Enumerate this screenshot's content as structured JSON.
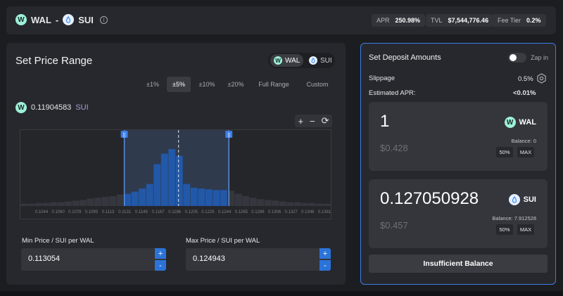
{
  "header": {
    "token_a": "WAL",
    "separator": "-",
    "token_b": "SUI",
    "info_glyph": "i",
    "stats": [
      {
        "label": "APR",
        "value": "250.98%"
      },
      {
        "label": "TVL",
        "value": "$7,544,776.46"
      },
      {
        "label": "Fee Tier",
        "value": "0.2%"
      }
    ]
  },
  "range_panel": {
    "title": "Set Price Range",
    "token_toggle": {
      "token_a": "WAL",
      "token_b": "SUI",
      "selected": "WAL"
    },
    "range_options": [
      "±1%",
      "±5%",
      "±10%",
      "±20%",
      "Full Range",
      "Custom"
    ],
    "selected_range": "±5%",
    "current_price": "0.11904583",
    "current_price_unit": "SUI",
    "chart_controls": {
      "zoom_in": "+",
      "zoom_out": "−",
      "reset": "⟳"
    },
    "x_ticks": [
      "0.1044",
      "0.1060",
      "0.1078",
      "0.1095",
      "0.1113",
      "0.1131",
      "0.1149",
      "0.1167",
      "0.1186",
      "0.1205",
      "0.1225",
      "0.1244",
      "0.1265",
      "0.1286",
      "0.1306",
      "0.1327",
      "0.1348",
      "0.1381"
    ],
    "min_price_label": "Min Price / SUI per WAL",
    "min_price_value": "0.113054",
    "max_price_label": "Max Price / SUI per WAL",
    "max_price_value": "0.124943",
    "stepper_plus": "+",
    "stepper_minus": "-"
  },
  "liquidity_histogram": {
    "range_min_price": 0.113054,
    "range_max_price": 0.124943,
    "current_price": 0.11904583,
    "bar_levels": [
      0.03,
      0.03,
      0.04,
      0.04,
      0.05,
      0.05,
      0.06,
      0.07,
      0.08,
      0.1,
      0.11,
      0.12,
      0.13,
      0.15,
      0.16,
      0.19,
      0.23,
      0.29,
      0.55,
      0.69,
      0.75,
      0.66,
      0.29,
      0.24,
      0.23,
      0.22,
      0.21,
      0.21,
      0.2,
      0.16,
      0.13,
      0.11,
      0.09,
      0.08,
      0.07,
      0.06,
      0.05,
      0.05,
      0.04,
      0.04,
      0.03,
      0.03
    ]
  },
  "deposit_panel": {
    "title": "Set Deposit Amounts",
    "zap_label": "Zap in",
    "zap_enabled": false,
    "slippage_label": "Slippage",
    "slippage_value": "0.5%",
    "est_apr_label": "Estimated APR:",
    "est_apr_value": "<0.01%",
    "token_a": {
      "amount": "1",
      "usd": "$0.428",
      "symbol": "WAL",
      "balance_label": "Balance:",
      "balance": "0",
      "half": "50%",
      "max": "MAX"
    },
    "token_b": {
      "amount": "0.127050928",
      "usd": "$0.457",
      "symbol": "SUI",
      "balance_label": "Balance:",
      "balance": "7.912528",
      "half": "50%",
      "max": "MAX"
    },
    "submit_label": "Insufficient Balance"
  },
  "colors": {
    "accent": "#2b73d8",
    "border_active": "#3b7ee6",
    "bar": "#2f63b3",
    "bar_in_range": "#2258a8",
    "wal_coin": "#9ef0d8"
  }
}
